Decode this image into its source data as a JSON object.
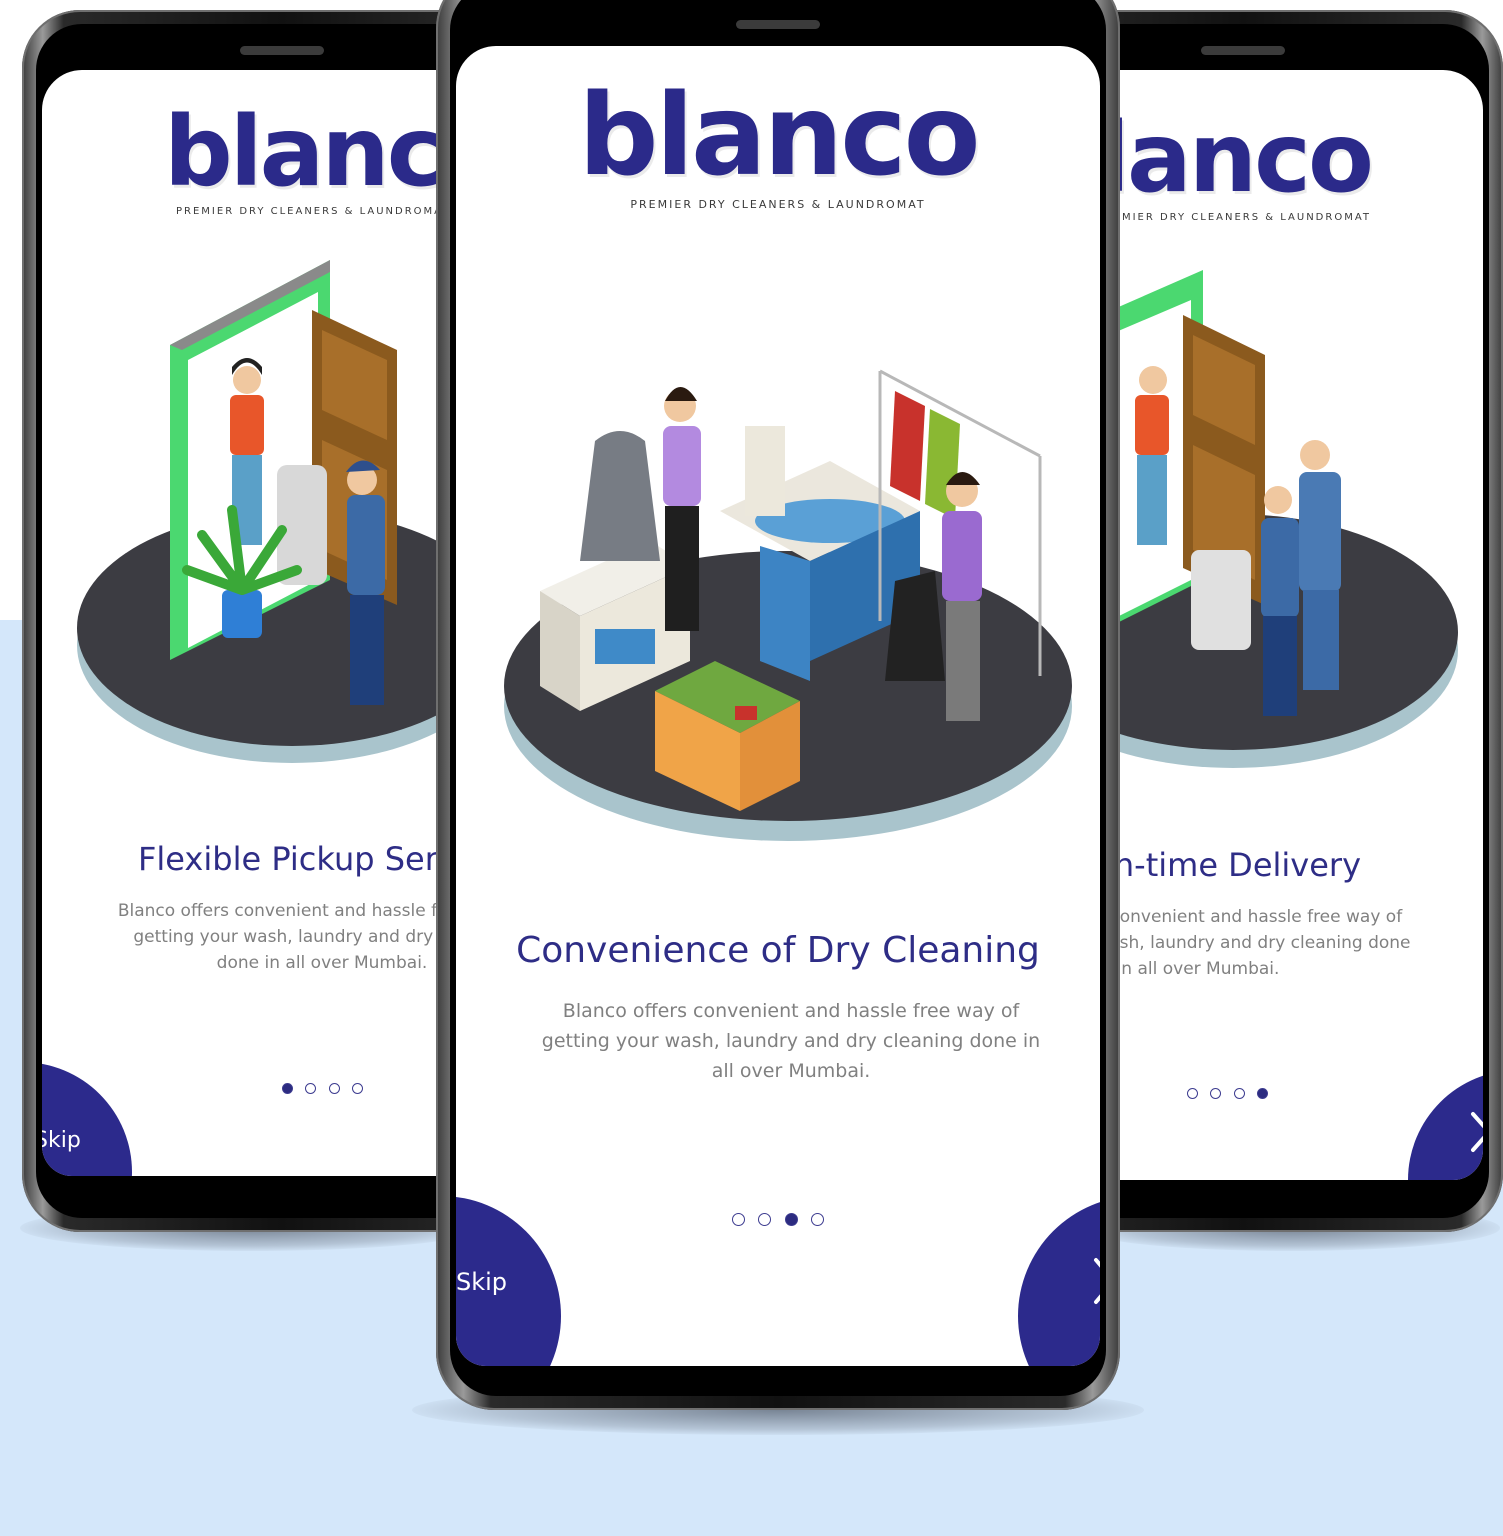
{
  "brand": {
    "name": "blanco",
    "tagline": "PREMIER DRY CLEANERS & LAUNDROMAT"
  },
  "slides": {
    "left": {
      "title": "Flexible Pickup Service",
      "description": "Blanco offers convenient and hassle free way of getting your wash, laundry and dry cleaning done in all over Mumbai.",
      "active_dot": 1,
      "skip_label": "Skip"
    },
    "center": {
      "title": "Convenience of Dry Cleaning",
      "description": "Blanco offers convenient and hassle free way of getting your wash, laundry and dry cleaning done in all over Mumbai.",
      "active_dot": 3,
      "skip_label": "Skip",
      "next_icon": "chevron-right-icon"
    },
    "right": {
      "title": "On-time Delivery",
      "description": "Blanco offers convenient and hassle free way of getting your wash, laundry and dry cleaning done in all over Mumbai.",
      "active_dot": 4,
      "next_icon": "chevron-right-icon"
    }
  },
  "dots_total": 4,
  "colors": {
    "brand": "#2c2a8c",
    "background_band": "#d4e7fa",
    "platform": "#3c3c42",
    "platform_rim": "#a9c4cc"
  }
}
